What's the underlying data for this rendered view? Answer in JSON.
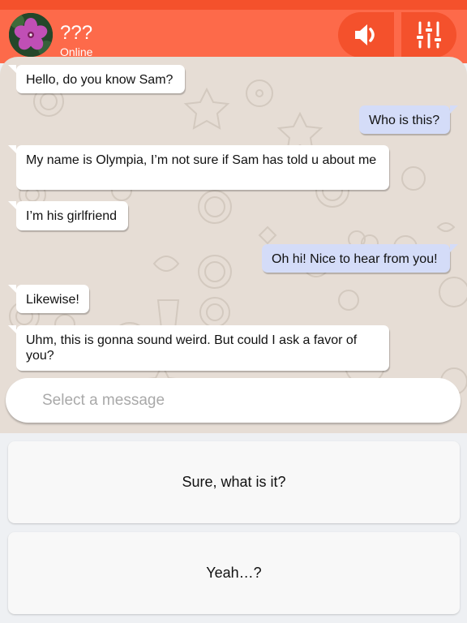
{
  "header": {
    "contact_name": "???",
    "status": "Online",
    "colors": {
      "bar": "#fd6a4a",
      "strip": "#f4512c",
      "button": "#f4512c"
    },
    "icons": [
      "flower-avatar",
      "speaker-icon",
      "sliders-icon"
    ]
  },
  "messages": [
    {
      "side": "in",
      "text": "Hello, do you know Sam?"
    },
    {
      "side": "out",
      "text": "Who is this?"
    },
    {
      "side": "in",
      "text": "My name is Olympia, I’m not sure if Sam has told u about me"
    },
    {
      "side": "in",
      "text": "I’m his girlfriend"
    },
    {
      "side": "out",
      "text": "Oh hi! Nice to hear from you!"
    },
    {
      "side": "in",
      "text": "Likewise!"
    },
    {
      "side": "in",
      "text": "Uhm, this is gonna sound weird. But could I ask a favor of you?"
    }
  ],
  "composer": {
    "placeholder": "Select a message"
  },
  "replies": [
    {
      "label": "Sure, what is it?"
    },
    {
      "label": "Yeah…?"
    }
  ]
}
